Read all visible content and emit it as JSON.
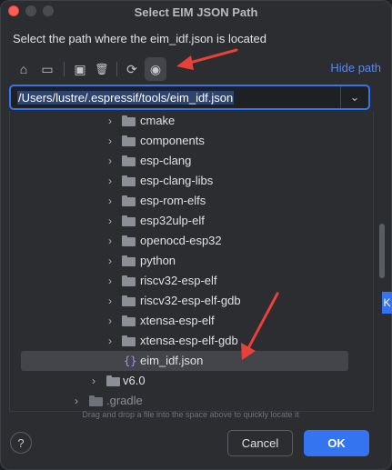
{
  "dialog": {
    "title": "Select EIM JSON Path",
    "subtitle": "Select the path where the eim_idf.json is located"
  },
  "toolbar": {
    "buttons": [
      {
        "name": "home-icon",
        "glyph": "⌂"
      },
      {
        "name": "desktop-icon",
        "glyph": "▭"
      },
      {
        "name": "new-folder-icon",
        "glyph": "▣"
      },
      {
        "name": "delete-icon",
        "glyph": "🗑"
      },
      {
        "name": "refresh-icon",
        "glyph": "⟳"
      },
      {
        "name": "show-hidden-icon",
        "glyph": "◉"
      }
    ],
    "hide_path_label": "Hide path"
  },
  "path": {
    "value": "/Users/lustre/.espressif/tools/eim_idf.json",
    "dropdown_glyph": "⌄"
  },
  "tree": {
    "rows": [
      {
        "label": "cmake",
        "kind": "folder",
        "expand": "›"
      },
      {
        "label": "components",
        "kind": "folder",
        "expand": "›"
      },
      {
        "label": "esp-clang",
        "kind": "folder",
        "expand": "›"
      },
      {
        "label": "esp-clang-libs",
        "kind": "folder",
        "expand": "›"
      },
      {
        "label": "esp-rom-elfs",
        "kind": "folder",
        "expand": "›"
      },
      {
        "label": "esp32ulp-elf",
        "kind": "folder",
        "expand": "›"
      },
      {
        "label": "openocd-esp32",
        "kind": "folder",
        "expand": "›"
      },
      {
        "label": "python",
        "kind": "folder",
        "expand": "›"
      },
      {
        "label": "riscv32-esp-elf",
        "kind": "folder",
        "expand": "›"
      },
      {
        "label": "riscv32-esp-elf-gdb",
        "kind": "folder",
        "expand": "›"
      },
      {
        "label": "xtensa-esp-elf",
        "kind": "folder",
        "expand": "›"
      },
      {
        "label": "xtensa-esp-elf-gdb",
        "kind": "folder",
        "expand": "›"
      },
      {
        "label": "eim_idf.json",
        "kind": "json",
        "icon": "{}"
      },
      {
        "label": "v6.0",
        "kind": "folder",
        "expand": "›"
      },
      {
        "label": ".gradle",
        "kind": "folder-dim",
        "expand": "›"
      }
    ]
  },
  "hint": "Drag and drop a file into the space above to quickly locate it",
  "buttons": {
    "help": "?",
    "cancel": "Cancel",
    "ok": "OK"
  },
  "edge_fragment": "K",
  "colors": {
    "accent": "#3574f0",
    "annotation_arrow": "#e8403a",
    "link": "#548af7"
  }
}
